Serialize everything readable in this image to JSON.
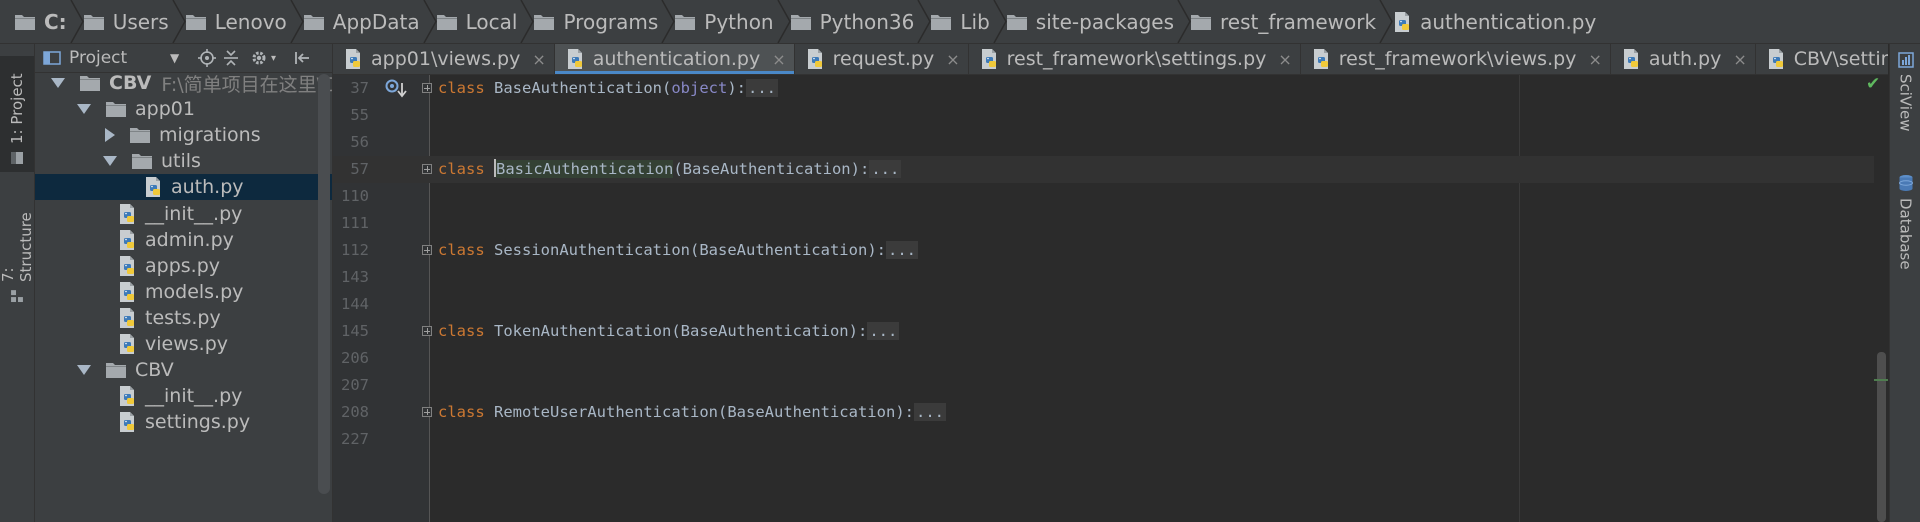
{
  "breadcrumb": [
    {
      "label": "C:",
      "icon": "drive-icon"
    },
    {
      "label": "Users",
      "icon": "folder-icon"
    },
    {
      "label": "Lenovo",
      "icon": "folder-icon"
    },
    {
      "label": "AppData",
      "icon": "folder-icon"
    },
    {
      "label": "Local",
      "icon": "folder-icon"
    },
    {
      "label": "Programs",
      "icon": "folder-icon"
    },
    {
      "label": "Python",
      "icon": "folder-icon"
    },
    {
      "label": "Python36",
      "icon": "folder-icon"
    },
    {
      "label": "Lib",
      "icon": "folder-icon"
    },
    {
      "label": "site-packages",
      "icon": "folder-icon"
    },
    {
      "label": "rest_framework",
      "icon": "folder-icon"
    },
    {
      "label": "authentication.py",
      "icon": "python-file-icon"
    }
  ],
  "left_strip": {
    "project_tab": "1: Project",
    "structure_tab": "7: Structure"
  },
  "project_panel": {
    "title": "Project",
    "tree": [
      {
        "label": "CBV",
        "suffix": "F:\\简单项目在这里\\CBV",
        "kind": "root",
        "expand": "down"
      },
      {
        "label": "app01",
        "kind": "folder",
        "expand": "down"
      },
      {
        "label": "migrations",
        "kind": "folder",
        "expand": "right"
      },
      {
        "label": "utils",
        "kind": "folder",
        "expand": "down"
      },
      {
        "label": "auth.py",
        "kind": "file",
        "selected": true
      },
      {
        "label": "__init__.py",
        "kind": "file"
      },
      {
        "label": "admin.py",
        "kind": "file"
      },
      {
        "label": "apps.py",
        "kind": "file"
      },
      {
        "label": "models.py",
        "kind": "file"
      },
      {
        "label": "tests.py",
        "kind": "file"
      },
      {
        "label": "views.py",
        "kind": "file"
      },
      {
        "label": "CBV",
        "kind": "folder",
        "expand": "down"
      },
      {
        "label": "__init__.py",
        "kind": "file"
      },
      {
        "label": "settings.py",
        "kind": "file"
      }
    ]
  },
  "tabs": [
    {
      "label": "app01\\views.py",
      "active": false,
      "close": "×"
    },
    {
      "label": "authentication.py",
      "active": true,
      "close": "×"
    },
    {
      "label": "request.py",
      "active": false,
      "close": "×"
    },
    {
      "label": "rest_framework\\settings.py",
      "active": false,
      "close": "×"
    },
    {
      "label": "rest_framework\\views.py",
      "active": false,
      "close": "×"
    },
    {
      "label": "auth.py",
      "active": false,
      "close": "×"
    },
    {
      "label": "CBV\\settings.py",
      "active": false,
      "close": "×"
    }
  ],
  "tab_overflow": "▾≡",
  "editor": {
    "lines": [
      {
        "num": "37",
        "fold": true,
        "kw": "class",
        "name": "BaseAuthentication",
        "open": "(",
        "base": "object",
        "close": "):",
        "ellipsis": "...",
        "builtin": true
      },
      {
        "num": "55"
      },
      {
        "num": "56"
      },
      {
        "num": "57",
        "fold": true,
        "kw": "class",
        "name": "BasicAuthentication",
        "open": "(",
        "base": "BaseAuthentication",
        "close": "):",
        "ellipsis": "...",
        "current": true
      },
      {
        "num": "110"
      },
      {
        "num": "111"
      },
      {
        "num": "112",
        "fold": true,
        "kw": "class",
        "name": "SessionAuthentication",
        "open": "(",
        "base": "BaseAuthentication",
        "close": "):",
        "ellipsis": "..."
      },
      {
        "num": "143"
      },
      {
        "num": "144"
      },
      {
        "num": "145",
        "fold": true,
        "kw": "class",
        "name": "TokenAuthentication",
        "open": "(",
        "base": "BaseAuthentication",
        "close": "):",
        "ellipsis": "..."
      },
      {
        "num": "206"
      },
      {
        "num": "207"
      },
      {
        "num": "208",
        "fold": true,
        "kw": "class",
        "name": "RemoteUserAuthentication",
        "open": "(",
        "base": "BaseAuthentication",
        "close": "):",
        "ellipsis": "..."
      },
      {
        "num": "227"
      }
    ]
  },
  "right_strip": {
    "sciview_tab": "SciView",
    "database_tab": "Database"
  },
  "colors": {
    "keyword": "#cc7832",
    "identifier": "#a9b7c6",
    "builtin": "#8888c6",
    "selection": "#0d293e",
    "tab_underline": "#4a88c7",
    "ok_check": "#5fb85f"
  }
}
